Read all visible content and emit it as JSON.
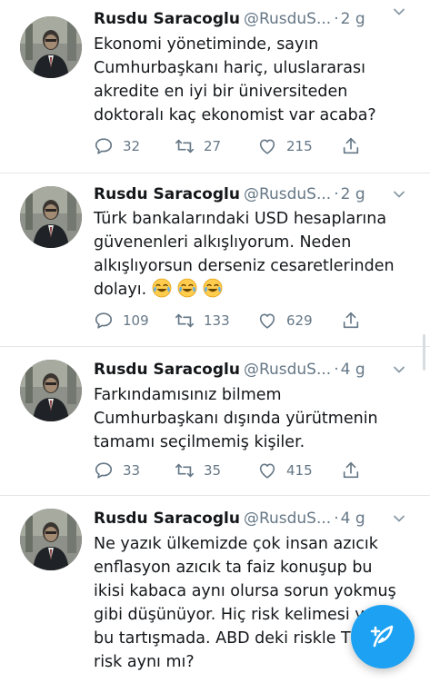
{
  "tweets": [
    {
      "name": "Rusdu Saracoglu",
      "handle": "@RusduS...",
      "separator": "·",
      "time": "2 g",
      "text": "Ekonomi yönetiminde, sayın\nCumhurbaşkanı hariç, uluslararası\nakredite en iyi bir üniversiteden\ndoktoralı kaç ekonomist var acaba?",
      "replies": "32",
      "retweets": "27",
      "likes": "215"
    },
    {
      "name": "Rusdu Saracoglu",
      "handle": "@RusduS...",
      "separator": "·",
      "time": "2 g",
      "text": "Türk bankalarındaki USD hesaplarına\ngüvenenleri alkışlıyorum. Neden\nalkışlıyorsun derseniz cesaretlerinden\ndolayı.",
      "emoji": [
        "face-with-tears-of-joy",
        "face-with-tears-of-joy",
        "face-with-tears-of-joy"
      ],
      "replies": "109",
      "retweets": "133",
      "likes": "629"
    },
    {
      "name": "Rusdu Saracoglu",
      "handle": "@RusduS...",
      "separator": "·",
      "time": "4 g",
      "text": "Farkındamısınız bilmem\nCumhurbaşkanı dışında yürütmenin\ntamamı seçilmemiş kişiler.",
      "replies": "33",
      "retweets": "35",
      "likes": "415"
    },
    {
      "name": "Rusdu Saracoglu",
      "handle": "@RusduS...",
      "separator": "·",
      "time": "4 g",
      "text": "Ne yazık ülkemizde çok insan  azıcık\nenflasyon azıcık ta faiz konuşup bu\nikisi kabaca aynı olursa sorun  yokmuş\ngibi düşünüyor. Hiç risk kelimesi y\nbu tartışmada. ABD deki riskle T\nrisk aynı mı?"
    }
  ],
  "icons": {
    "reply": "reply-icon",
    "retweet": "retweet-icon",
    "like": "heart-icon",
    "share": "share-icon",
    "caret": "chevron-down-icon",
    "compose": "compose-tweet-icon"
  },
  "colors": {
    "accent": "#1da1f2",
    "secondary_text": "#657786",
    "divider": "#e3e6e8"
  }
}
